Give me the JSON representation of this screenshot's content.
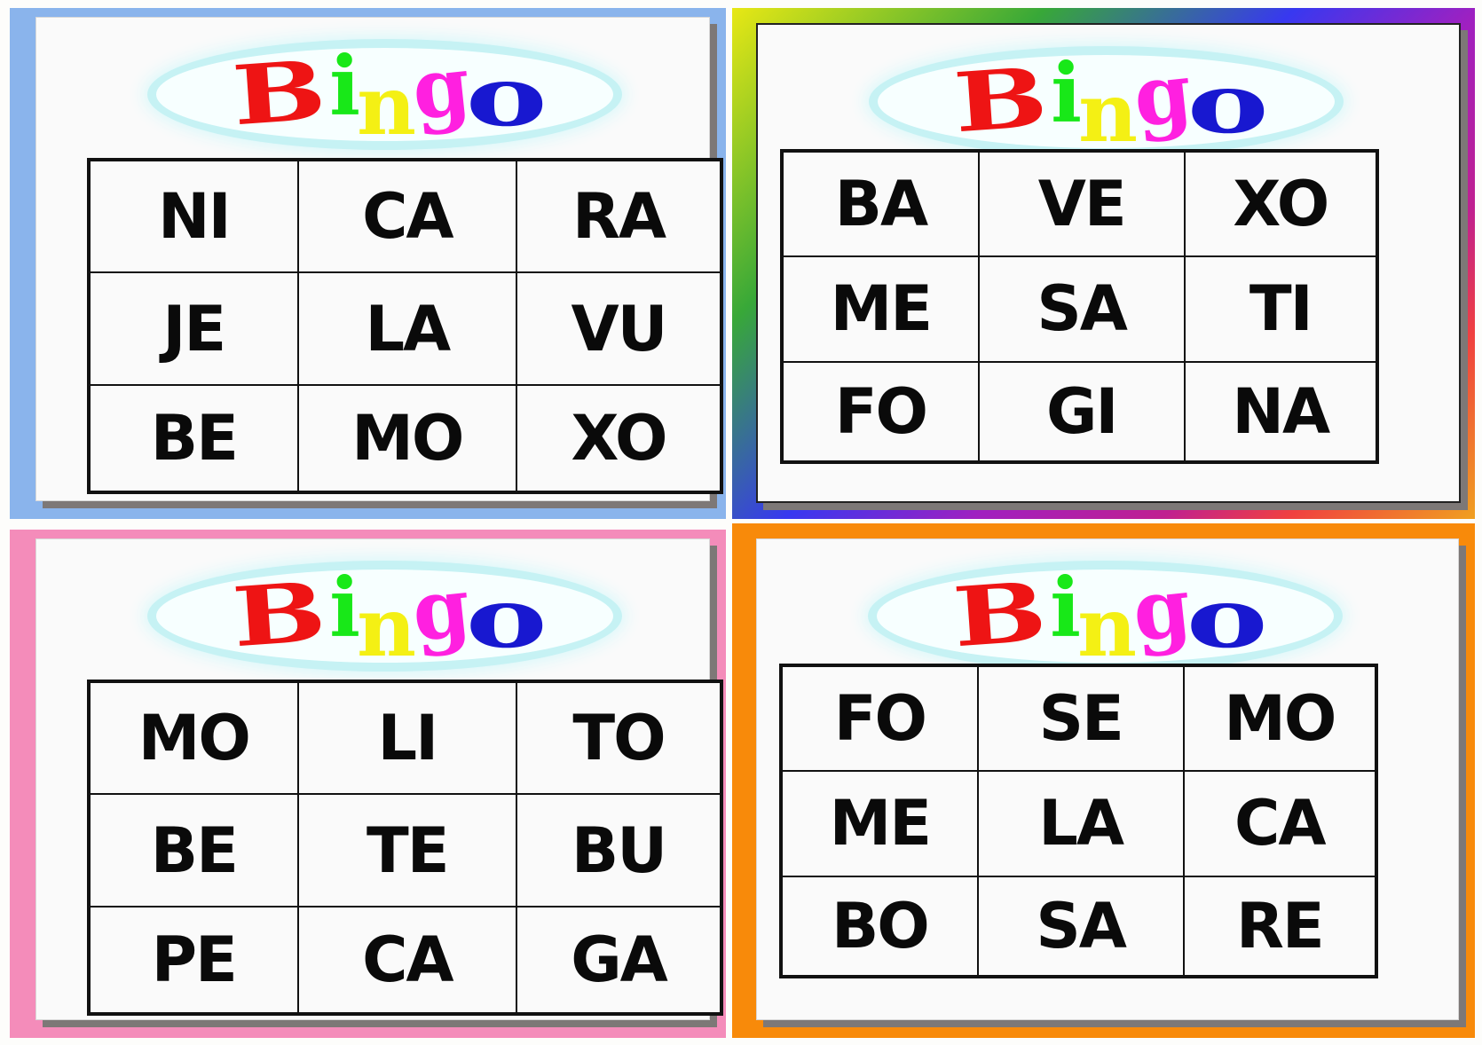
{
  "logo": {
    "text": "Bingo",
    "letters": [
      "B",
      "i",
      "n",
      "g",
      "o"
    ]
  },
  "cards": [
    {
      "border_color": "#8ab4ec",
      "cells": [
        "NI",
        "CA",
        "RA",
        "JE",
        "LA",
        "VU",
        "BE",
        "MO",
        "XO"
      ]
    },
    {
      "border_color": "rainbow",
      "cells": [
        "BA",
        "VE",
        "XO",
        "ME",
        "SA",
        "TI",
        "FO",
        "GI",
        "NA"
      ]
    },
    {
      "border_color": "#f48cba",
      "cells": [
        "MO",
        "LI",
        "TO",
        "BE",
        "TE",
        "BU",
        "PE",
        "CA",
        "GA"
      ]
    },
    {
      "border_color": "#f88a0a",
      "cells": [
        "FO",
        "SE",
        "MO",
        "ME",
        "LA",
        "CA",
        "BO",
        "SA",
        "RE"
      ]
    }
  ]
}
